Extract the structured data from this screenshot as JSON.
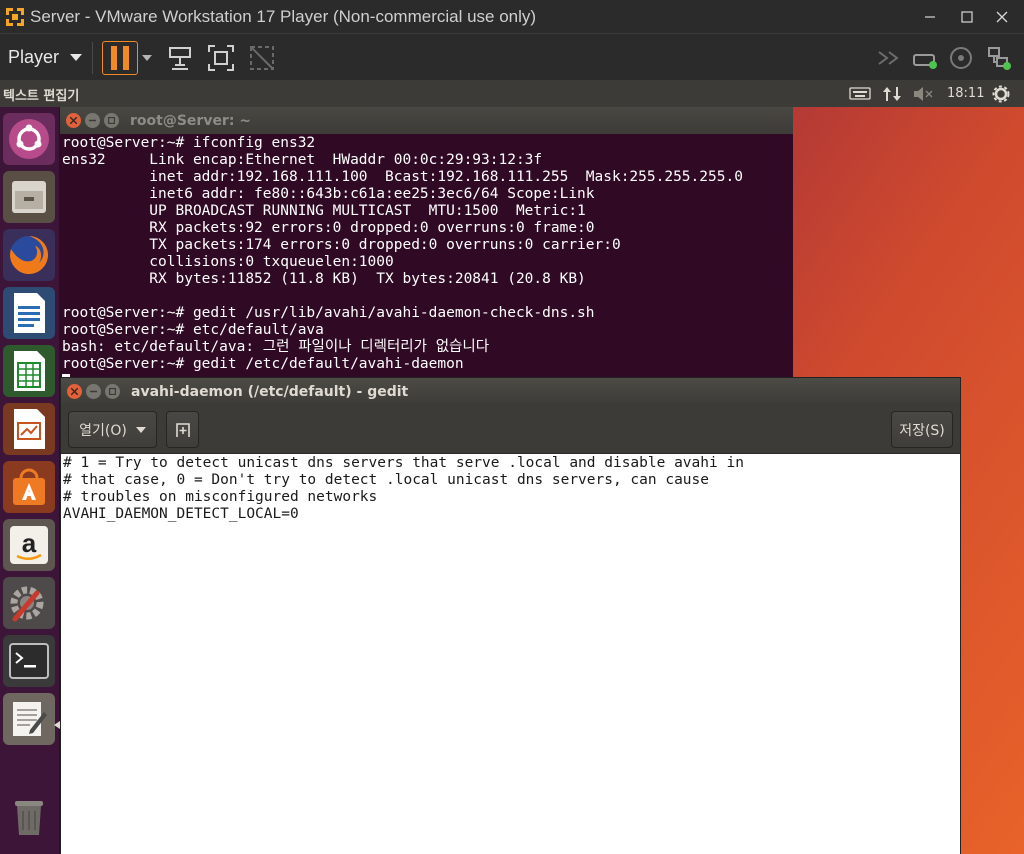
{
  "vmware": {
    "title": "Server - VMware Workstation 17 Player (Non-commercial use only)",
    "player_label": "Player"
  },
  "ubuntu_panel": {
    "app_title": "텍스트 편집기",
    "clock": "18:11"
  },
  "terminal": {
    "title": "root@Server: ~",
    "lines": [
      "root@Server:~# ifconfig ens32",
      "ens32     Link encap:Ethernet  HWaddr 00:0c:29:93:12:3f",
      "          inet addr:192.168.111.100  Bcast:192.168.111.255  Mask:255.255.255.0",
      "          inet6 addr: fe80::643b:c61a:ee25:3ec6/64 Scope:Link",
      "          UP BROADCAST RUNNING MULTICAST  MTU:1500  Metric:1",
      "          RX packets:92 errors:0 dropped:0 overruns:0 frame:0",
      "          TX packets:174 errors:0 dropped:0 overruns:0 carrier:0",
      "          collisions:0 txqueuelen:1000",
      "          RX bytes:11852 (11.8 KB)  TX bytes:20841 (20.8 KB)",
      "",
      "root@Server:~# gedit /usr/lib/avahi/avahi-daemon-check-dns.sh",
      "root@Server:~# etc/default/ava",
      "bash: etc/default/ava: 그런 파일이나 디렉터리가 없습니다",
      "root@Server:~# gedit /etc/default/avahi-daemon"
    ]
  },
  "gedit": {
    "title": "avahi-daemon (/etc/default) - gedit",
    "open_label": "열기(O)",
    "save_label": "저장(S)",
    "content_lines": [
      "# 1 = Try to detect unicast dns servers that serve .local and disable avahi in",
      "# that case, 0 = Don't try to detect .local unicast dns servers, can cause",
      "# troubles on misconfigured networks",
      "AVAHI_DAEMON_DETECT_LOCAL=0"
    ]
  },
  "launcher_icons": [
    "ubuntu-dash-icon",
    "files-icon",
    "firefox-icon",
    "writer-icon",
    "calc-icon",
    "impress-icon",
    "software-center-icon",
    "amazon-icon",
    "system-settings-icon",
    "terminal-icon",
    "text-editor-icon",
    "trash-icon"
  ],
  "colors": {
    "terminal_bg": "#300a24",
    "launcher_bg": "#3d1538",
    "panel_bg": "#3c3b37",
    "close_button": "#e2613a",
    "vmware_pause": "#f08a24"
  }
}
